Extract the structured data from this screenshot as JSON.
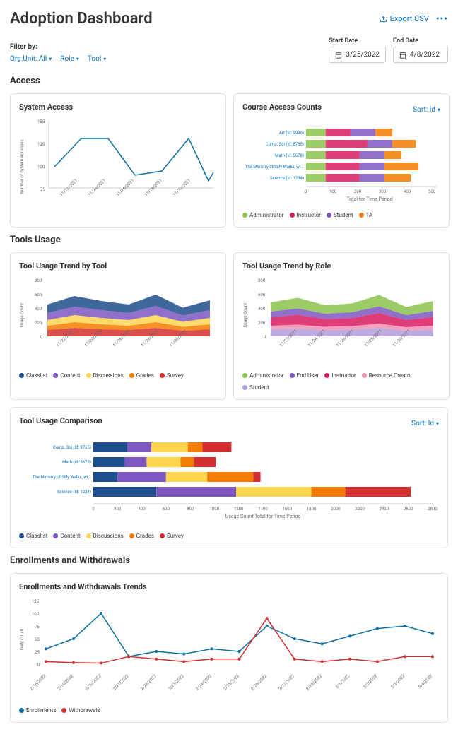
{
  "header": {
    "title": "Adoption Dashboard",
    "export": "Export CSV"
  },
  "filters": {
    "label": "Filter by:",
    "chips": [
      {
        "label": "Org Unit: All"
      },
      {
        "label": "Role"
      },
      {
        "label": "Tool"
      }
    ],
    "start_label": "Start Date",
    "start_value": "3/25/2022",
    "end_label": "End Date",
    "end_value": "4/8/2022"
  },
  "sections": {
    "access": "Access",
    "tools": "Tools Usage",
    "enrollments": "Enrollments and Withdrawals"
  },
  "cards": {
    "system_access": "System Access",
    "course_access": "Course Access Counts",
    "tool_by_tool": "Tool Usage Trend by Tool",
    "tool_by_role": "Tool Usage Trend by Role",
    "comparison": "Tool Usage Comparison",
    "enrollments": "Enrollments and Withdrawals Trends"
  },
  "sort": "Sort: Id",
  "axes": {
    "system_y": "Number of System Accesses",
    "usage_y": "Usage Count",
    "course_x": "Total for Time Period",
    "comparison_x": "Usage Count Total for Time Period",
    "daily_y": "Daily Count"
  },
  "colors": {
    "blue": "#0b6fa4",
    "navy": "#1f4e8c",
    "green": "#8bc34a",
    "magenta": "#d81b60",
    "purple": "#7e57c2",
    "orange": "#f57c00",
    "yellow": "#ffd54f",
    "red": "#d32f2f",
    "violet": "#b39ddb",
    "pink": "#f48fb1"
  },
  "legends": {
    "roles": [
      "Administrator",
      "Instructor",
      "Student",
      "TA"
    ],
    "tools": [
      "Classlist",
      "Content",
      "Discussions",
      "Grades",
      "Survey"
    ],
    "roles2": [
      "Administrator",
      "End User",
      "Instructor",
      "Resource Creator",
      "Student"
    ],
    "enroll": [
      "Enrollments",
      "Withdrawals"
    ]
  },
  "chart_data": {
    "system_access": {
      "type": "line",
      "ylabel": "Number of System Accesses",
      "ylim": [
        75,
        150
      ],
      "categories": [
        "11/22/2021",
        "11/24/2021",
        "11/26/2021",
        "11/28/2021",
        "11/30/2021"
      ],
      "values": [
        100,
        130,
        90,
        95,
        130,
        85,
        95
      ]
    },
    "course_access": {
      "type": "bar_stacked_horizontal",
      "xlabel": "Total for Time Period",
      "xlim": [
        0,
        500
      ],
      "categories": [
        "Art (Id: 9999)",
        "Comp. Sci (Id: 8765)",
        "Math (Id: 5678)",
        "The Ministry of Silly Walks, wi...",
        "Science (Id: 1234)"
      ],
      "series": [
        {
          "name": "Administrator",
          "values": [
            75,
            75,
            75,
            75,
            75
          ]
        },
        {
          "name": "Instructor",
          "values": [
            95,
            160,
            130,
            130,
            130
          ]
        },
        {
          "name": "Student",
          "values": [
            95,
            95,
            95,
            95,
            95
          ]
        },
        {
          "name": "TA",
          "values": [
            65,
            90,
            65,
            130,
            100
          ]
        }
      ]
    },
    "tool_by_tool": {
      "type": "area_stacked",
      "ylabel": "Usage Count",
      "ylim": [
        0,
        800
      ],
      "categories": [
        "11/22/2021",
        "11/24/2021",
        "11/26/2021",
        "11/28/2021",
        "11/30/2021"
      ],
      "series": [
        {
          "name": "Classlist",
          "values": [
            120,
            150,
            130,
            120,
            160,
            110,
            140
          ]
        },
        {
          "name": "Content",
          "values": [
            100,
            120,
            110,
            100,
            130,
            90,
            110
          ]
        },
        {
          "name": "Discussions",
          "values": [
            80,
            100,
            90,
            80,
            100,
            70,
            90
          ]
        },
        {
          "name": "Grades",
          "values": [
            60,
            80,
            70,
            60,
            80,
            55,
            70
          ]
        },
        {
          "name": "Survey",
          "values": [
            90,
            120,
            100,
            90,
            120,
            80,
            100
          ]
        }
      ]
    },
    "tool_by_role": {
      "type": "area_stacked",
      "ylabel": "Usage Count",
      "ylim": [
        0,
        800
      ],
      "categories": [
        "11/22/2021",
        "11/24/2021",
        "11/26/2021",
        "11/28/2021",
        "11/30/2021"
      ],
      "series": [
        {
          "name": "Administrator",
          "values": [
            130,
            150,
            120,
            125,
            160,
            115,
            140
          ]
        },
        {
          "name": "End User",
          "values": [
            80,
            90,
            75,
            80,
            95,
            70,
            85
          ]
        },
        {
          "name": "Instructor",
          "values": [
            120,
            140,
            110,
            115,
            150,
            100,
            125
          ]
        },
        {
          "name": "Resource Creator",
          "values": [
            50,
            55,
            45,
            50,
            60,
            45,
            50
          ]
        },
        {
          "name": "Student",
          "values": [
            100,
            110,
            90,
            95,
            120,
            85,
            100
          ]
        }
      ]
    },
    "comparison": {
      "type": "bar_stacked_horizontal",
      "xlabel": "Usage Count Total for Time Period",
      "xlim": [
        0,
        2800
      ],
      "categories": [
        "Comp. Sci (Id: 8765)",
        "Math (Id: 5678)",
        "The Ministry of Silly Walks, wi...",
        "Science (Id: 1234)"
      ],
      "series": [
        {
          "name": "Classlist",
          "values": [
            280,
            260,
            200,
            520
          ]
        },
        {
          "name": "Content",
          "values": [
            200,
            180,
            400,
            660
          ]
        },
        {
          "name": "Discussions",
          "values": [
            300,
            280,
            340,
            620
          ]
        },
        {
          "name": "Grades",
          "values": [
            120,
            110,
            380,
            280
          ]
        },
        {
          "name": "Survey",
          "values": [
            240,
            180,
            60,
            540
          ]
        }
      ]
    },
    "enrollments": {
      "type": "line",
      "ylabel": "Daily Count",
      "ylim": [
        0,
        125
      ],
      "categories": [
        "2/18/2022",
        "2/19/2022",
        "2/20/2022",
        "2/21/2022",
        "2/22/2022",
        "2/23/2022",
        "2/24/2022",
        "2/25/2022",
        "2/26/2022",
        "2/27/2022",
        "2/28/2022",
        "3/1/2022",
        "3/2/2022",
        "3/3/2022",
        "3/4/2022"
      ],
      "series": [
        {
          "name": "Enrollments",
          "values": [
            30,
            50,
            100,
            15,
            25,
            20,
            30,
            25,
            75,
            50,
            40,
            55,
            70,
            75,
            60
          ]
        },
        {
          "name": "Withdrawals",
          "values": [
            5,
            3,
            2,
            15,
            10,
            5,
            10,
            10,
            90,
            10,
            5,
            10,
            5,
            15,
            15
          ]
        }
      ]
    }
  }
}
